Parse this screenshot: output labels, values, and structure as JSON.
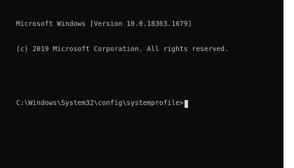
{
  "console": {
    "version_line": "Microsoft Windows [Version 10.0.18363.1679]",
    "copyright_line": "(c) 2019 Microsoft Corporation. All rights reserved.",
    "prompt": "C:\\Windows\\System32\\config\\systemprofile>"
  },
  "colors": {
    "background": "#0c0c0c",
    "text": "#bcbcbc",
    "cursor": "#d6d6d6"
  }
}
